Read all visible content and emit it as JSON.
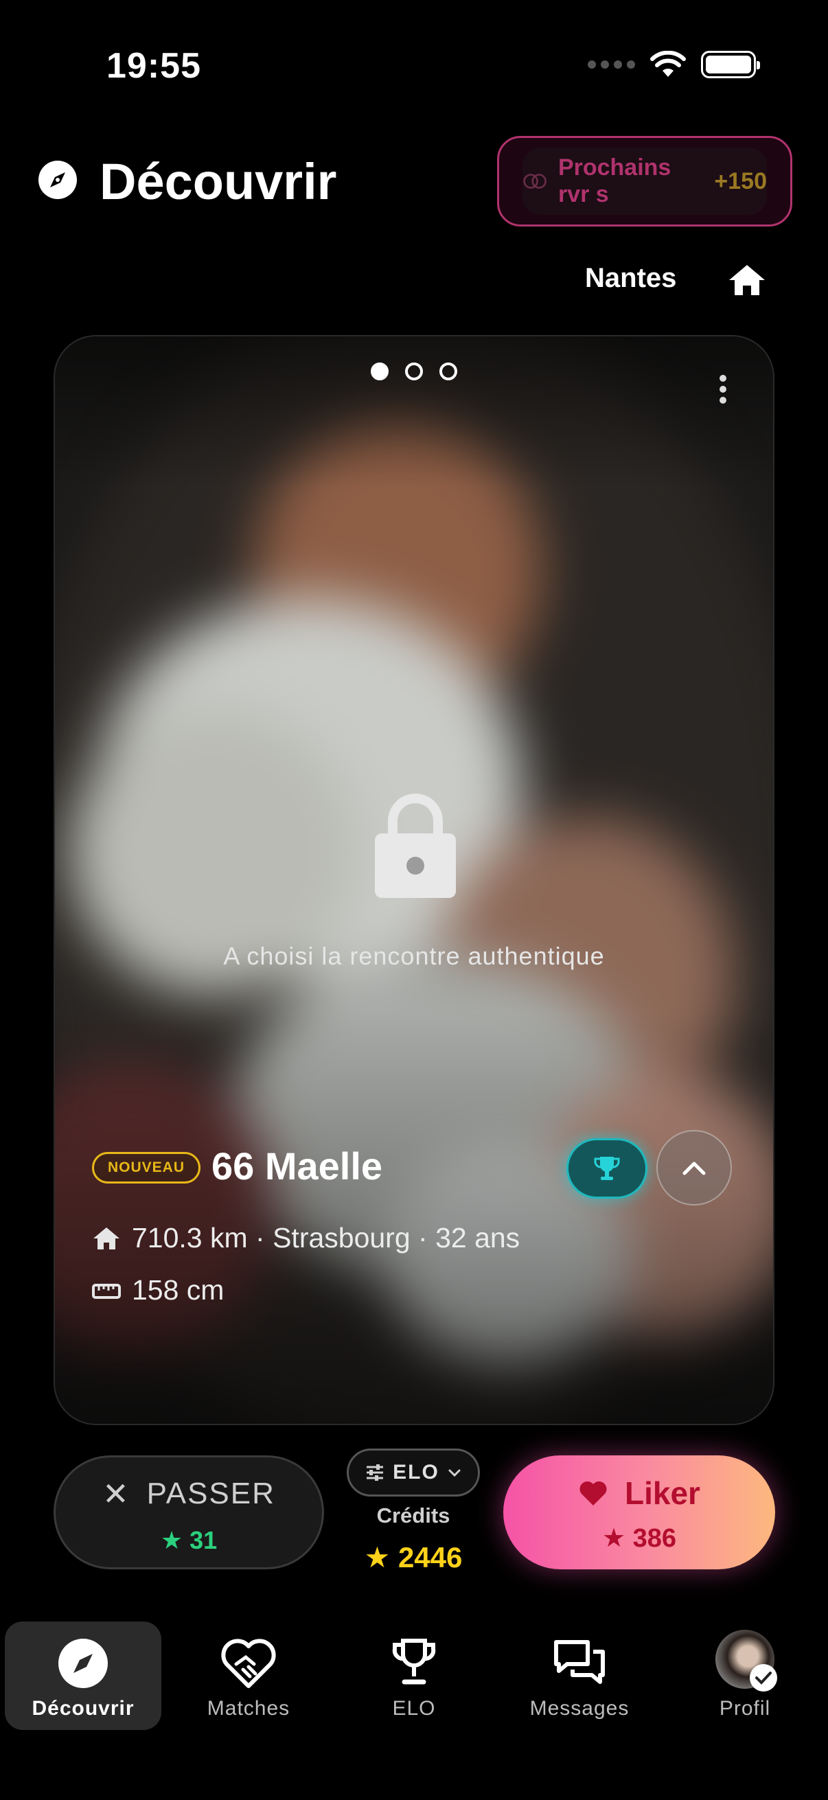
{
  "status_bar": {
    "time": "19:55"
  },
  "header": {
    "title": "Découvrir",
    "reveal_pill": {
      "label": "Prochains rvr s",
      "cost": "+150"
    },
    "city": "Nantes"
  },
  "card": {
    "pager": {
      "count": 3,
      "active_index": 0
    },
    "locked_text": "A choisi la rencontre authentique",
    "badge": "NOUVEAU",
    "name": "66 Maelle",
    "details": {
      "location": "710.3 km · Strasbourg · 32 ans",
      "height": "158 cm"
    }
  },
  "actions": {
    "pass": {
      "label": "PASSER",
      "cost": "★ 31"
    },
    "elo_selector": {
      "label": "ELO"
    },
    "credits": {
      "title": "Crédits",
      "value": "2446"
    },
    "like": {
      "label": "Liker",
      "cost": "★ 386"
    }
  },
  "tabs": [
    {
      "label": "Découvrir",
      "icon": "compass-icon",
      "active": true
    },
    {
      "label": "Matches",
      "icon": "heart-handshake-icon",
      "active": false
    },
    {
      "label": "ELO",
      "icon": "trophy-icon",
      "active": false
    },
    {
      "label": "Messages",
      "icon": "chat-bubbles-icon",
      "active": false
    },
    {
      "label": "Profil",
      "icon": "avatar",
      "active": false
    }
  ],
  "colors": {
    "accent_pink": "#f553a7",
    "accent_peach": "#fdb87e",
    "like_text": "#b30d2f",
    "pass_cost_green": "#2bd17e",
    "credits_gold": "#ffd21a",
    "badge_gold": "#e8b818",
    "trophy_teal": "#1fb9bd"
  }
}
